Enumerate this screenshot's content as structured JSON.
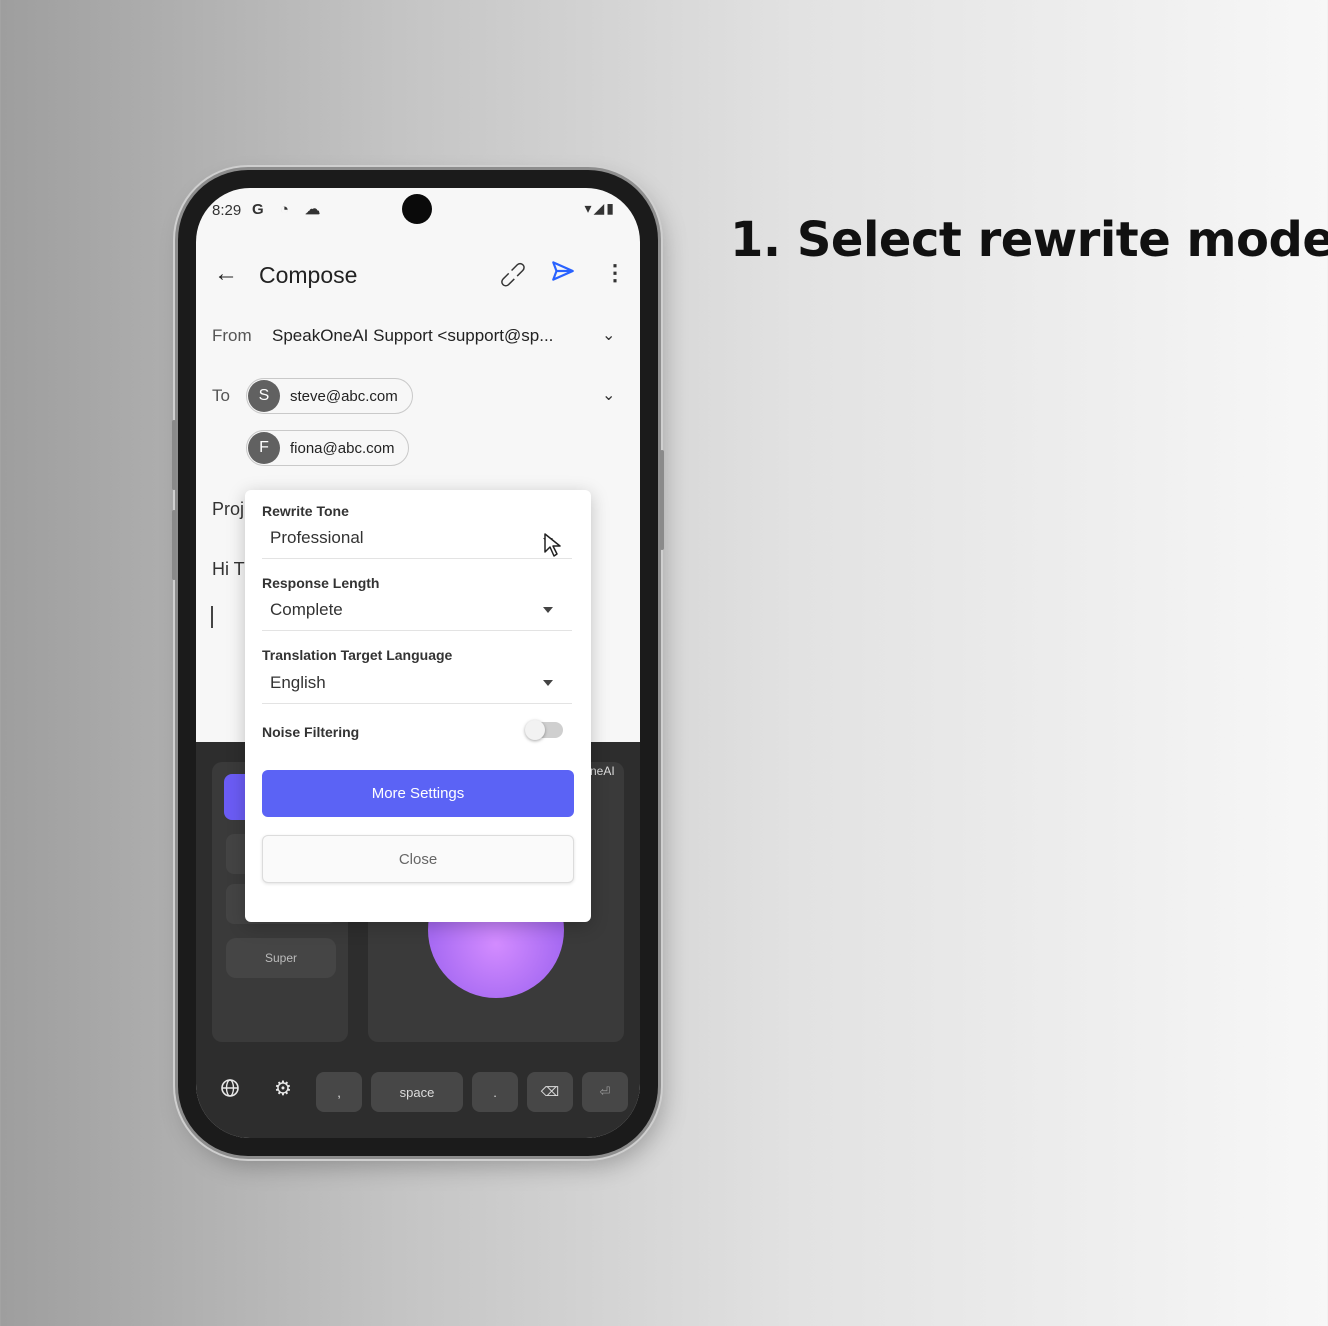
{
  "headline": "1. Select rewrite mode",
  "status_bar": {
    "time": "8:29",
    "left_icons": "G ◔ ☁",
    "right_icons": "▾◢▮"
  },
  "app_bar": {
    "title": "Compose"
  },
  "compose": {
    "from_label": "From",
    "from_value": "SpeakOneAI Support <support@sp...",
    "to_label": "To",
    "recipients": [
      {
        "initial": "S",
        "email": "steve@abc.com"
      },
      {
        "initial": "F",
        "email": "fiona@abc.com"
      }
    ],
    "subject_partial": "Proj",
    "body_partial": "Hi T"
  },
  "popup": {
    "rewrite_tone": {
      "label": "Rewrite Tone",
      "value": "Professional"
    },
    "response_length": {
      "label": "Response Length",
      "value": "Complete"
    },
    "translation_language": {
      "label": "Translation Target Language",
      "value": "English"
    },
    "noise_filtering": {
      "label": "Noise Filtering",
      "enabled": false
    },
    "more_settings_label": "More Settings",
    "close_label": "Close",
    "primary_color": "#5b63f5"
  },
  "keyboard": {
    "super_label": "Super",
    "brand_partial": "neAI",
    "keys": {
      "comma": ",",
      "space": "space",
      "period": ".",
      "backspace": "⌫",
      "enter": "⏎"
    },
    "orb_color": "#b877f7"
  }
}
